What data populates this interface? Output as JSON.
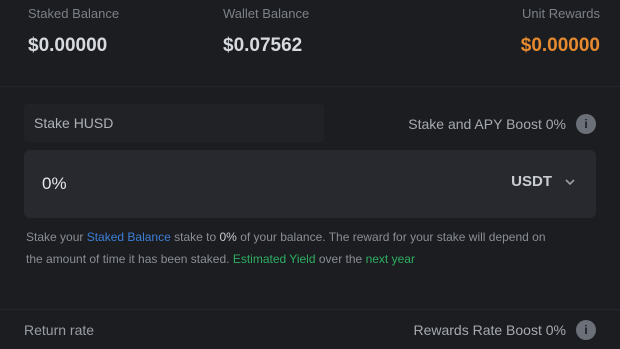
{
  "stats": [
    {
      "label": "Staked Balance",
      "value": "$0.00000"
    },
    {
      "label": "Wallet Balance",
      "value": "$0.07562"
    },
    {
      "label": "Unit Rewards",
      "value": "$0.00000"
    }
  ],
  "stake": {
    "tab_label": "Stake HUSD",
    "link_label": "Stake and APY Boost 0%",
    "amount_value": "0%",
    "currency": "USDT"
  },
  "description": {
    "prefix": "Stake your",
    "link": "Staked Balance",
    "middle": "stake to",
    "pct": "0%",
    "rest": "of your balance. The reward for",
    "line2": "your stake will depend on the amount of time it has been staked.",
    "green1": "Estimated Yield",
    "between": "over the",
    "green2": "next year"
  },
  "bottom": {
    "left_label": "Return rate",
    "right_label": "Rewards Rate Boost 0%"
  },
  "colors": {
    "accent_orange": "#e58a2f",
    "link_blue": "#3d7fd6",
    "success_green": "#2fae61"
  },
  "icons": {
    "info": "info-icon",
    "chevron": "chevron-down-icon"
  }
}
